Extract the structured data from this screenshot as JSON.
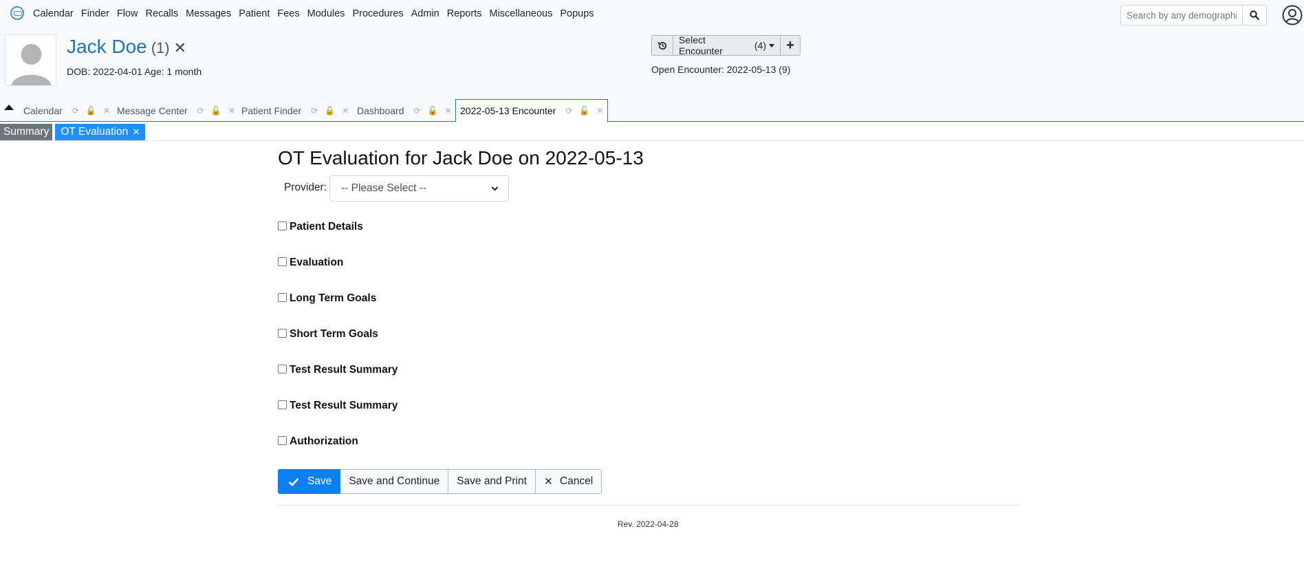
{
  "nav": {
    "items": [
      "Calendar",
      "Finder",
      "Flow",
      "Recalls",
      "Messages",
      "Patient",
      "Fees",
      "Modules",
      "Procedures",
      "Admin",
      "Reports",
      "Miscellaneous",
      "Popups"
    ],
    "search_placeholder": "Search by any demographics"
  },
  "patient": {
    "name": "Jack Doe",
    "id": "(1)",
    "dob_line": "DOB: 2022-04-01 Age: 1 month"
  },
  "encounter": {
    "select_label": "Select Encounter",
    "count": "(4)",
    "open_line": "Open Encounter: 2022-05-13 (9)"
  },
  "tabs": [
    {
      "label": "Calendar",
      "active": false
    },
    {
      "label": "Message Center",
      "active": false
    },
    {
      "label": "Patient Finder",
      "active": false
    },
    {
      "label": "Dashboard",
      "active": false
    },
    {
      "label": "2022-05-13 Encounter",
      "active": true
    }
  ],
  "subtabs": {
    "summary": "Summary",
    "ot": "OT Evaluation"
  },
  "form": {
    "title": "OT Evaluation for Jack Doe on 2022-05-13",
    "provider_label": "Provider:",
    "provider_selected": "-- Please Select --",
    "sections": [
      "Patient Details",
      "Evaluation",
      "Long Term Goals",
      "Short Term Goals",
      "Test Result Summary",
      "Test Result Summary",
      "Authorization"
    ],
    "buttons": {
      "save": "Save",
      "save_continue": "Save and Continue",
      "save_print": "Save and Print",
      "cancel": "Cancel"
    },
    "revision": "Rev. 2022-04-28"
  },
  "colors": {
    "accent": "#1e73be",
    "primary_button": "#0d7ff2",
    "active_subtab": "#1e90ff",
    "summary_subtab": "#6c757d"
  }
}
